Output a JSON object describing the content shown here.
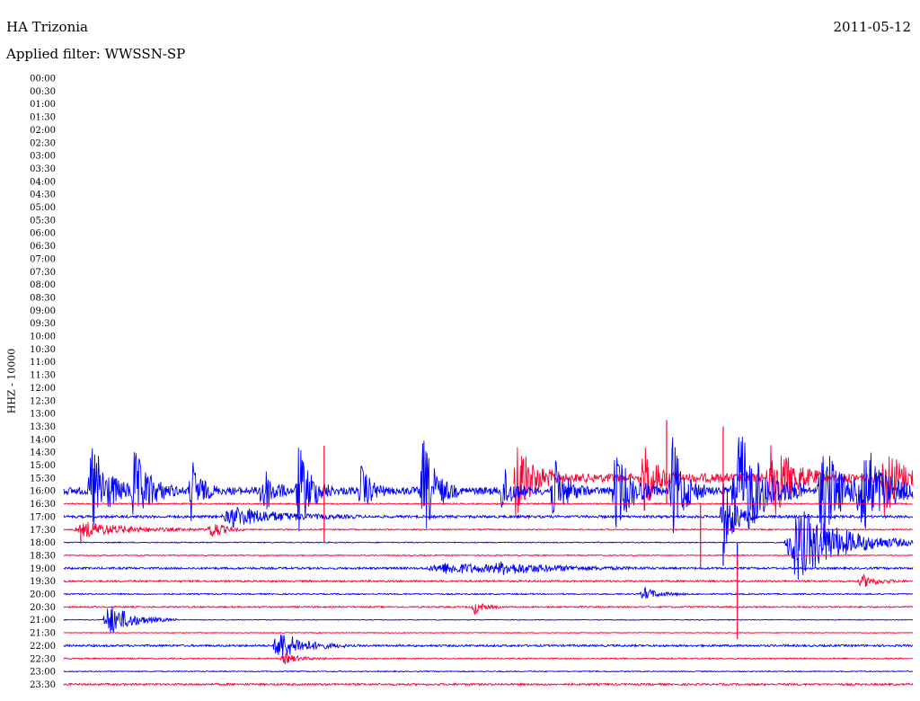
{
  "header": {
    "station": "HA Trizonia",
    "date": "2011-05-12",
    "filter": "Applied filter: WWSSN-SP"
  },
  "chart_data": {
    "type": "line",
    "title": "HA Trizonia",
    "ylabel": "HHZ - 10000",
    "x_unit": "minutes within 30-minute row",
    "time_labels": [
      "00:00",
      "00:30",
      "01:00",
      "01:30",
      "02:00",
      "02:30",
      "03:00",
      "03:30",
      "04:00",
      "04:30",
      "05:00",
      "05:30",
      "06:00",
      "06:30",
      "07:00",
      "07:30",
      "08:00",
      "08:30",
      "09:00",
      "09:30",
      "10:00",
      "10:30",
      "11:00",
      "11:30",
      "12:00",
      "12:30",
      "13:00",
      "13:30",
      "14:00",
      "14:30",
      "15:00",
      "15:30",
      "16:00",
      "16:30",
      "17:00",
      "17:30",
      "18:00",
      "18:30",
      "19:00",
      "19:30",
      "20:00",
      "20:30",
      "21:00",
      "21:30",
      "22:00",
      "22:30",
      "23:00",
      "23:30"
    ],
    "trace_colors": [
      "#ff0033",
      "#0000ff"
    ],
    "data_start": "15:30",
    "series": [
      {
        "time": "15:30",
        "color": "#ff0033",
        "noise": 0.35,
        "start": 0.53
      },
      {
        "time": "16:00",
        "color": "#0000ff",
        "noise": 0.3
      },
      {
        "time": "16:30",
        "color": "#ff0033",
        "noise": 0.05
      },
      {
        "time": "17:00",
        "color": "#0000ff",
        "noise": 0.1
      },
      {
        "time": "17:30",
        "color": "#ff0033",
        "noise": 0.05
      },
      {
        "time": "18:00",
        "color": "#0000ff",
        "noise": 0.04
      },
      {
        "time": "18:30",
        "color": "#ff0033",
        "noise": 0.04
      },
      {
        "time": "19:00",
        "color": "#0000ff",
        "noise": 0.08
      },
      {
        "time": "19:30",
        "color": "#ff0033",
        "noise": 0.07
      },
      {
        "time": "20:00",
        "color": "#0000ff",
        "noise": 0.05
      },
      {
        "time": "20:30",
        "color": "#ff0033",
        "noise": 0.06
      },
      {
        "time": "21:00",
        "color": "#0000ff",
        "noise": 0.03
      },
      {
        "time": "21:30",
        "color": "#ff0033",
        "noise": 0.03
      },
      {
        "time": "22:00",
        "color": "#0000ff",
        "noise": 0.08
      },
      {
        "time": "22:30",
        "color": "#ff0033",
        "noise": 0.05
      },
      {
        "time": "23:00",
        "color": "#0000ff",
        "noise": 0.04
      },
      {
        "time": "23:30",
        "color": "#ff0033",
        "noise": 0.08
      }
    ],
    "events": [
      {
        "time": "15:30",
        "minute": 0.3,
        "amp": 4,
        "dur": 0.3
      },
      {
        "time": "15:30",
        "minute": 1.5,
        "amp": 3,
        "dur": 0.3
      },
      {
        "time": "15:30",
        "minute": 6.0,
        "amp": 2.5,
        "dur": 0.4
      },
      {
        "time": "15:30",
        "minute": 10.5,
        "amp": 3.5,
        "dur": 0.4
      },
      {
        "time": "15:30",
        "minute": 16.0,
        "amp": 3.5,
        "dur": 0.5
      },
      {
        "time": "15:30",
        "minute": 20.5,
        "amp": 2.5,
        "dur": 0.4
      },
      {
        "time": "15:30",
        "minute": 25.0,
        "amp": 3.5,
        "dur": 0.6
      },
      {
        "time": "15:30",
        "minute": 29.0,
        "amp": 3,
        "dur": 0.5
      },
      {
        "time": "16:00",
        "minute": 1.0,
        "amp": 4,
        "dur": 0.5
      },
      {
        "time": "16:00",
        "minute": 2.5,
        "amp": 3,
        "dur": 0.5
      },
      {
        "time": "16:00",
        "minute": 4.5,
        "amp": 2.5,
        "dur": 0.3
      },
      {
        "time": "16:00",
        "minute": 7.0,
        "amp": 2.5,
        "dur": 0.3
      },
      {
        "time": "16:00",
        "minute": 8.3,
        "amp": 3.5,
        "dur": 0.4
      },
      {
        "time": "16:00",
        "minute": 10.5,
        "amp": 2,
        "dur": 0.3
      },
      {
        "time": "16:00",
        "minute": 12.7,
        "amp": 4,
        "dur": 0.4
      },
      {
        "time": "16:00",
        "minute": 15.5,
        "amp": 2,
        "dur": 0.3
      },
      {
        "time": "16:00",
        "minute": 17.3,
        "amp": 2.5,
        "dur": 0.4
      },
      {
        "time": "16:00",
        "minute": 19.5,
        "amp": 3,
        "dur": 0.5
      },
      {
        "time": "16:00",
        "minute": 21.5,
        "amp": 4,
        "dur": 0.4
      },
      {
        "time": "16:00",
        "minute": 23.8,
        "amp": 5,
        "dur": 0.8
      },
      {
        "time": "16:00",
        "minute": 26.8,
        "amp": 4,
        "dur": 0.6
      },
      {
        "time": "16:00",
        "minute": 28.2,
        "amp": 4,
        "dur": 0.7
      },
      {
        "time": "17:00",
        "minute": 6.0,
        "amp": 0.8,
        "dur": 1.5
      },
      {
        "time": "17:00",
        "minute": 23.3,
        "amp": 3,
        "dur": 0.4
      },
      {
        "time": "17:30",
        "minute": 0.8,
        "amp": 0.6,
        "dur": 1.5
      },
      {
        "time": "17:30",
        "minute": 5.2,
        "amp": 0.8,
        "dur": 0.4
      },
      {
        "time": "18:00",
        "minute": 25.9,
        "amp": 3,
        "dur": 1.5
      },
      {
        "time": "19:00",
        "minute": 13.5,
        "amp": 0.4,
        "dur": 2.5
      },
      {
        "time": "19:00",
        "minute": 15.5,
        "amp": 0.3,
        "dur": 1.5
      },
      {
        "time": "19:30",
        "minute": 28.2,
        "amp": 0.5,
        "dur": 0.5
      },
      {
        "time": "20:00",
        "minute": 20.5,
        "amp": 0.5,
        "dur": 0.5
      },
      {
        "time": "20:30",
        "minute": 14.5,
        "amp": 0.6,
        "dur": 0.3
      },
      {
        "time": "21:00",
        "minute": 1.6,
        "amp": 1.3,
        "dur": 0.8
      },
      {
        "time": "22:00",
        "minute": 7.6,
        "amp": 1.2,
        "dur": 0.8
      },
      {
        "time": "22:30",
        "minute": 7.8,
        "amp": 0.4,
        "dur": 0.5
      }
    ],
    "spikes": [
      {
        "time": "16:30",
        "minute": 21.3,
        "up": 6.5,
        "down": 0
      },
      {
        "time": "16:30",
        "minute": 22.5,
        "up": 0,
        "down": 5
      },
      {
        "time": "16:30",
        "minute": 23.3,
        "up": 6,
        "down": 0
      },
      {
        "time": "17:30",
        "minute": 0.6,
        "up": 0,
        "down": 1.0
      },
      {
        "time": "17:30",
        "minute": 9.2,
        "up": 6.5,
        "down": 1.0
      },
      {
        "time": "17:30",
        "minute": 26.0,
        "up": 0,
        "down": 1.0
      },
      {
        "time": "18:00",
        "minute": 23.3,
        "up": 0,
        "down": 1.8
      },
      {
        "time": "18:00",
        "minute": 23.8,
        "up": 0,
        "down": 1.8
      },
      {
        "time": "18:30",
        "minute": 23.8,
        "up": 0,
        "down": 6.5
      }
    ]
  }
}
